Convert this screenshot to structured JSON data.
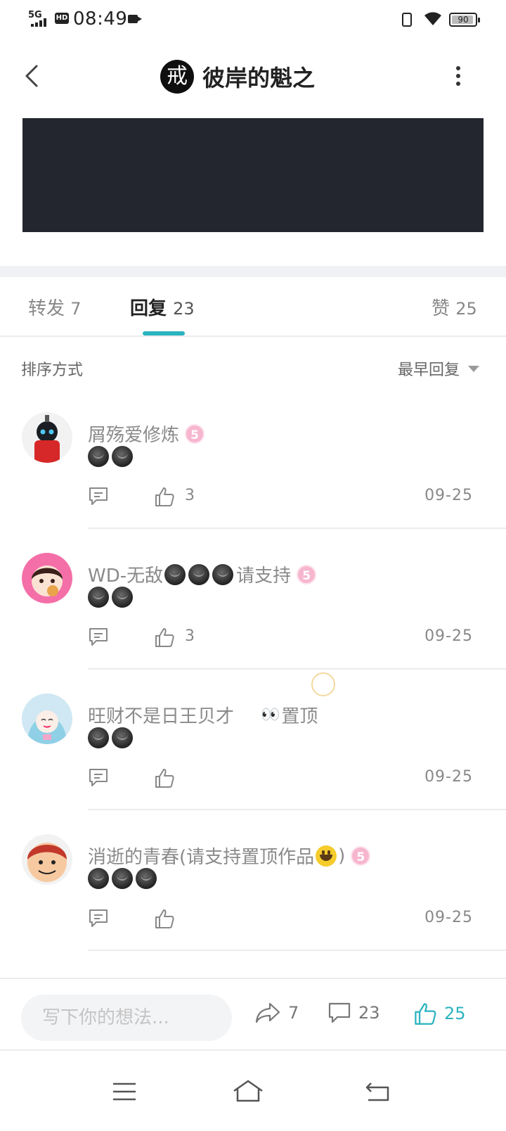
{
  "status_bar": {
    "signal": "5G",
    "hd": "HD",
    "time": "08:49",
    "battery": "90"
  },
  "header": {
    "avatar_char": "戒",
    "title": "彼岸的魁之"
  },
  "tabs": [
    {
      "label": "转发",
      "count": "7"
    },
    {
      "label": "回复",
      "count": "23"
    },
    {
      "label": "赞",
      "count": "25"
    }
  ],
  "sort": {
    "label": "排序方式",
    "selected": "最早回复"
  },
  "comments": [
    {
      "name": "屑殇爱修炼",
      "level": "5",
      "likes": "3",
      "date": "09-25"
    },
    {
      "name_prefix": "WD-无敌",
      "name_suffix": "请支持",
      "level": "5",
      "likes": "3",
      "date": "09-25"
    },
    {
      "name": "旺财不是日王贝才",
      "name_suffix": "置顶",
      "likes": "",
      "date": "09-25"
    },
    {
      "name_prefix": "消逝的青春(请支持置顶作品",
      "name_suffix": ")",
      "level": "5",
      "likes": "",
      "date": "09-25"
    }
  ],
  "bottom_bar": {
    "placeholder": "写下你的想法...",
    "share_count": "7",
    "comment_count": "23",
    "like_count": "25"
  },
  "colors": {
    "accent": "#2bb3c0",
    "level_badge": "#f7b6cf",
    "banner": "#23262f"
  }
}
